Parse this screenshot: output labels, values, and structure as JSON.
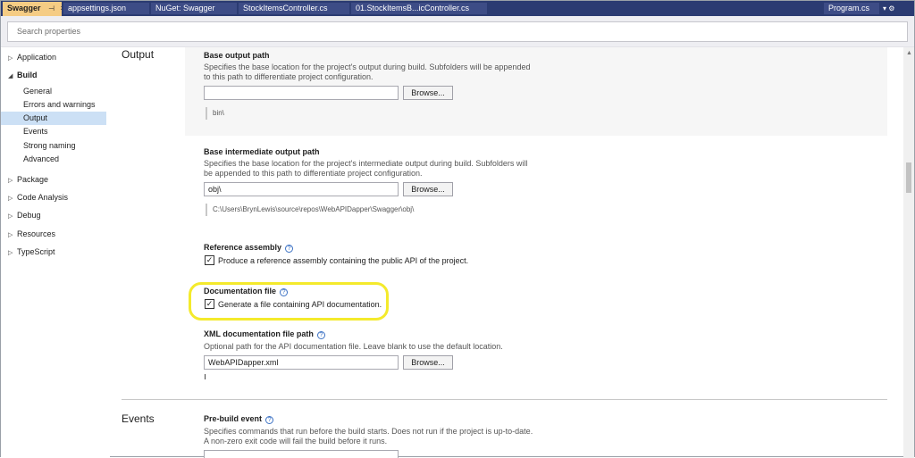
{
  "tabs": {
    "active": {
      "label": "Swagger",
      "pin": "⊣",
      "close": "×"
    },
    "items": [
      {
        "label": "appsettings.json"
      },
      {
        "label": "NuGet: Swagger"
      },
      {
        "label": "StockItemsController.cs"
      },
      {
        "label": "01.StockItemsB...icController.cs"
      }
    ],
    "right": {
      "label": "Program.cs",
      "controls": "▾ ⚙"
    }
  },
  "search": {
    "placeholder": "Search properties"
  },
  "sidebar": {
    "items": [
      {
        "label": "Application",
        "caret": "▷"
      },
      {
        "label": "Build",
        "caret": "◢"
      },
      {
        "label": "General"
      },
      {
        "label": "Errors and warnings"
      },
      {
        "label": "Output"
      },
      {
        "label": "Events"
      },
      {
        "label": "Strong naming"
      },
      {
        "label": "Advanced"
      },
      {
        "label": "Package",
        "caret": "▷"
      },
      {
        "label": "Code Analysis",
        "caret": "▷"
      },
      {
        "label": "Debug",
        "caret": "▷"
      },
      {
        "label": "Resources",
        "caret": "▷"
      },
      {
        "label": "TypeScript",
        "caret": "▷"
      }
    ]
  },
  "main": {
    "output_title": "Output",
    "base_output": {
      "label": "Base output path",
      "desc1": "Specifies the base location for the project's output during build. Subfolders will be appended",
      "desc2": "to this path to differentiate project configuration.",
      "value": "",
      "browse": "Browse...",
      "evaluated": "bin\\"
    },
    "base_intermediate": {
      "label": "Base intermediate output path",
      "desc1": "Specifies the base location for the project's intermediate output during build. Subfolders will",
      "desc2": "be appended to this path to differentiate project configuration.",
      "value": "obj\\",
      "browse": "Browse...",
      "evaluated": "C:\\Users\\BrynLewis\\source\\repos\\WebAPIDapper\\Swagger\\obj\\"
    },
    "reference_assembly": {
      "label": "Reference assembly",
      "help": "?",
      "check": "✓",
      "checkbox_label": "Produce a reference assembly containing the public API of the project."
    },
    "documentation_file": {
      "label": "Documentation file",
      "help": "?",
      "check": "✓",
      "checkbox_label": "Generate a file containing API documentation."
    },
    "xml_doc_path": {
      "label": "XML documentation file path",
      "help": "?",
      "desc": "Optional path for the API documentation file. Leave blank to use the default location.",
      "value": "WebAPIDapper.xml",
      "browse": "Browse..."
    },
    "events_title": "Events",
    "pre_build": {
      "label": "Pre-build event",
      "help": "?",
      "desc1": "Specifies commands that run before the build starts. Does not run if the project is up-to-date.",
      "desc2": "A non-zero exit code will fail the build before it runs."
    }
  },
  "colors": {
    "tabstrip": "#2b3b72",
    "active_tab": "#f5cc84",
    "highlight": "#f4ea2c",
    "selected_nav": "#cce0f5"
  }
}
